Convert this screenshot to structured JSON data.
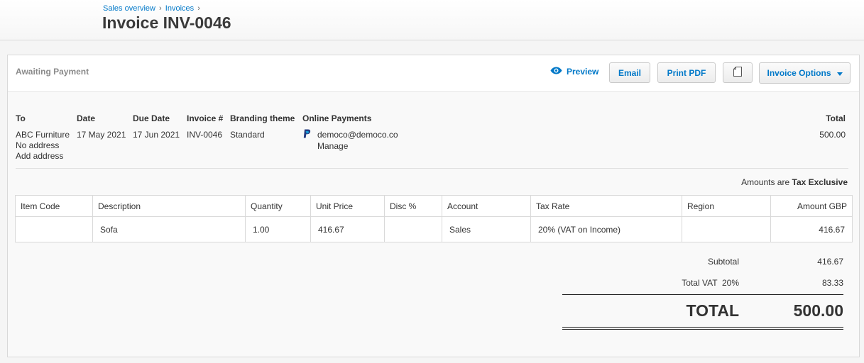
{
  "header": {
    "breadcrumb": [
      "Sales overview",
      "Invoices"
    ],
    "breadcrumb_sep": "›",
    "title": "Invoice INV-0046"
  },
  "toolbar": {
    "status": "Awaiting Payment",
    "preview": "Preview",
    "email": "Email",
    "print_pdf": "Print PDF",
    "copy_icon": "copy-document-icon",
    "options": "Invoice Options"
  },
  "details": {
    "to_label": "To",
    "to_name": "ABC Furniture",
    "to_address": "No address",
    "add_address": "Add address",
    "date_label": "Date",
    "date": "17 May 2021",
    "due_label": "Due Date",
    "due": "17 Jun 2021",
    "invoice_label": "Invoice #",
    "invoice": "INV-0046",
    "branding_label": "Branding theme",
    "branding": "Standard",
    "payments_label": "Online Payments",
    "payment_icon": "paypal-icon",
    "payment_account": "democo@democo.co",
    "manage": "Manage",
    "total_label": "Total",
    "total": "500.00"
  },
  "tax_note": {
    "prefix": "Amounts are",
    "mode": "Tax Exclusive"
  },
  "items": {
    "columns": [
      "Item Code",
      "Description",
      "Quantity",
      "Unit Price",
      "Disc %",
      "Account",
      "Tax Rate",
      "Region",
      "Amount GBP"
    ],
    "rows": [
      [
        "",
        "Sofa",
        "1.00",
        "416.67",
        "",
        "Sales",
        "20% (VAT on Income)",
        "",
        "416.67"
      ]
    ]
  },
  "totals": {
    "subtotal_label": "Subtotal",
    "subtotal": "416.67",
    "vat_label": "Total VAT  20%",
    "vat": "83.33",
    "grand_label": "TOTAL",
    "grand": "500.00"
  },
  "colors": {
    "link": "#0078c8",
    "paypal_dark": "#253b80",
    "paypal_light": "#179bd7"
  }
}
